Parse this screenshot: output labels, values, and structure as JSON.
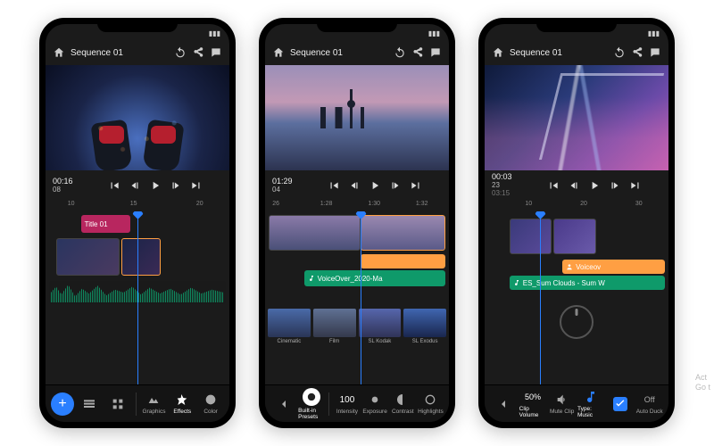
{
  "common": {
    "sequence_title": "Sequence 01",
    "undo_icon": "undo-icon",
    "share_icon": "share-icon",
    "comment_icon": "comment-icon",
    "home_icon": "home-icon"
  },
  "watermark": {
    "line1": "Act",
    "line2": "Go t"
  },
  "phone1": {
    "timecode": "00:16",
    "fps": "08",
    "ruler": [
      "10",
      "15",
      "20"
    ],
    "title_clip": "Title 01",
    "bottom": {
      "items": [
        "",
        "",
        "",
        "Graphics",
        "Effects",
        "Color"
      ]
    }
  },
  "phone2": {
    "timecode": "01:29",
    "fps": "04",
    "ruler": [
      "26",
      "1:28",
      "1:30",
      "1:32"
    ],
    "voiceover_label": "VoiceOver_2020-Ma",
    "presets": [
      "Cinematic",
      "Film",
      "SL Kodak",
      "SL Exodus"
    ],
    "bottom": {
      "builtin": "Built-in Presets",
      "v100": "100",
      "intensity": "Intensity",
      "exposure": "Exposure",
      "contrast": "Contrast",
      "highlights": "Highlights"
    }
  },
  "phone3": {
    "timecode": "00:03",
    "fps": "23",
    "duration": "03:15",
    "ruler": [
      "10",
      "20",
      "30"
    ],
    "voiceover_label": "Voiceov",
    "music_label": "ES_Sum Clouds - Sum W",
    "bottom": {
      "pct": "50%",
      "clipvol": "Clip Volume",
      "mute": "Mute Clip",
      "type": "Type: Music",
      "off": "Off",
      "autoduck": "Auto Duck"
    }
  }
}
